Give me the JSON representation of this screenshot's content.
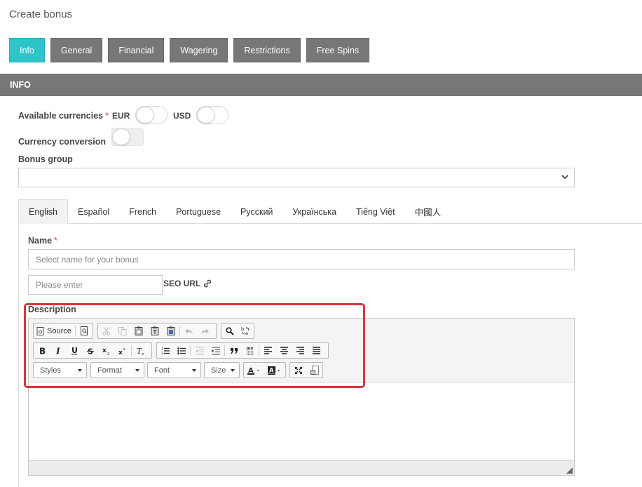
{
  "page": {
    "title": "Create bonus"
  },
  "top_tabs": [
    {
      "label": "Info",
      "active": true
    },
    {
      "label": "General",
      "active": false
    },
    {
      "label": "Financial",
      "active": false
    },
    {
      "label": "Wagering",
      "active": false
    },
    {
      "label": "Restrictions",
      "active": false
    },
    {
      "label": "Free Spins",
      "active": false
    }
  ],
  "section": {
    "title": "INFO"
  },
  "form": {
    "available_currencies_label": "Available currencies",
    "required_mark": "*",
    "currencies": [
      {
        "code": "EUR",
        "enabled": false
      },
      {
        "code": "USD",
        "enabled": false
      }
    ],
    "currency_conversion_label": "Currency conversion",
    "currency_conversion_enabled": false,
    "bonus_group_label": "Bonus group",
    "bonus_group_value": ""
  },
  "language_tabs": [
    {
      "label": "English",
      "active": true
    },
    {
      "label": "Español",
      "active": false
    },
    {
      "label": "French",
      "active": false
    },
    {
      "label": "Portuguese",
      "active": false
    },
    {
      "label": "Русский",
      "active": false
    },
    {
      "label": "Українська",
      "active": false
    },
    {
      "label": "Tiếng Việt",
      "active": false
    },
    {
      "label": "中國人",
      "active": false
    }
  ],
  "name_field": {
    "label": "Name",
    "required_mark": "*",
    "placeholder": "Select name for your bonus",
    "value": ""
  },
  "seo_field": {
    "placeholder": "Please enter",
    "value": "",
    "label": "SEO URL",
    "icon": "link-icon"
  },
  "description": {
    "label": "Description",
    "toolbar": {
      "source_label": "Source",
      "styles_label": "Styles",
      "format_label": "Format",
      "font_label": "Font",
      "size_label": "Size"
    },
    "content": ""
  },
  "colors": {
    "accent": "#2ec4c8",
    "tab_gray": "#777777",
    "highlight": "#d9363e",
    "required": "#e04848"
  }
}
